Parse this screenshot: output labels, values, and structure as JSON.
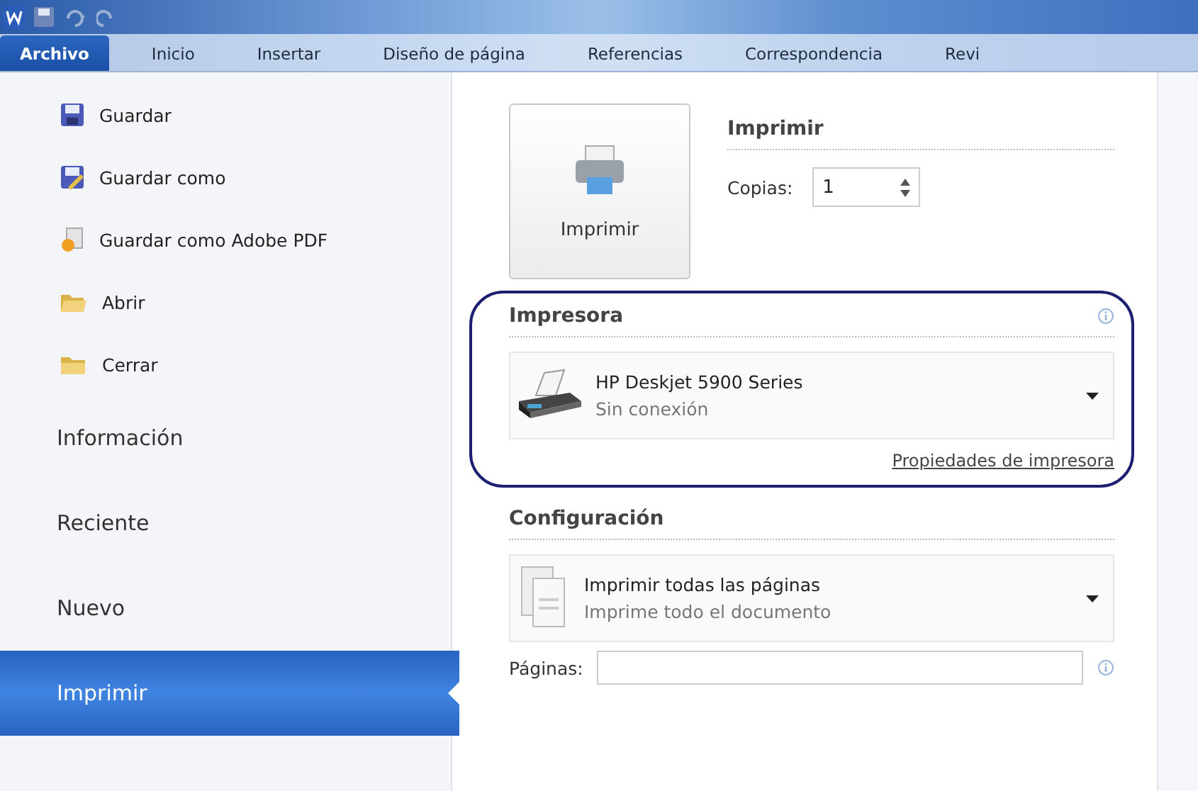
{
  "tabs": [
    {
      "label": "Archivo",
      "selected": true
    },
    {
      "label": "Inicio",
      "selected": false
    },
    {
      "label": "Insertar",
      "selected": false
    },
    {
      "label": "Diseño de página",
      "selected": false
    },
    {
      "label": "Referencias",
      "selected": false
    },
    {
      "label": "Correspondencia",
      "selected": false
    },
    {
      "label": "Revi",
      "selected": false
    }
  ],
  "sidebar": {
    "items": [
      {
        "kind": "command",
        "label": "Guardar",
        "selected": false
      },
      {
        "kind": "command",
        "label": "Guardar como",
        "selected": false
      },
      {
        "kind": "command",
        "label": "Guardar como Adobe PDF",
        "selected": false
      },
      {
        "kind": "command",
        "label": "Abrir",
        "selected": false
      },
      {
        "kind": "command",
        "label": "Cerrar",
        "selected": false
      },
      {
        "kind": "page",
        "label": "Información",
        "selected": false
      },
      {
        "kind": "page",
        "label": "Reciente",
        "selected": false
      },
      {
        "kind": "page",
        "label": "Nuevo",
        "selected": false
      },
      {
        "kind": "page",
        "label": "Imprimir",
        "selected": true
      }
    ]
  },
  "print": {
    "button": "Imprimir",
    "heading": "Imprimir",
    "copies_label": "Copias:",
    "copies": "1"
  },
  "printer": {
    "heading": "Impresora",
    "highlighted": true,
    "name": "HP Deskjet 5900 Series",
    "status": "Sin conexión",
    "link": "Propiedades de impresora"
  },
  "settings": {
    "heading": "Configuración",
    "option": "Imprimir todas las páginas",
    "option_detail": "Imprime todo el documento",
    "pages_label": "Páginas:"
  }
}
